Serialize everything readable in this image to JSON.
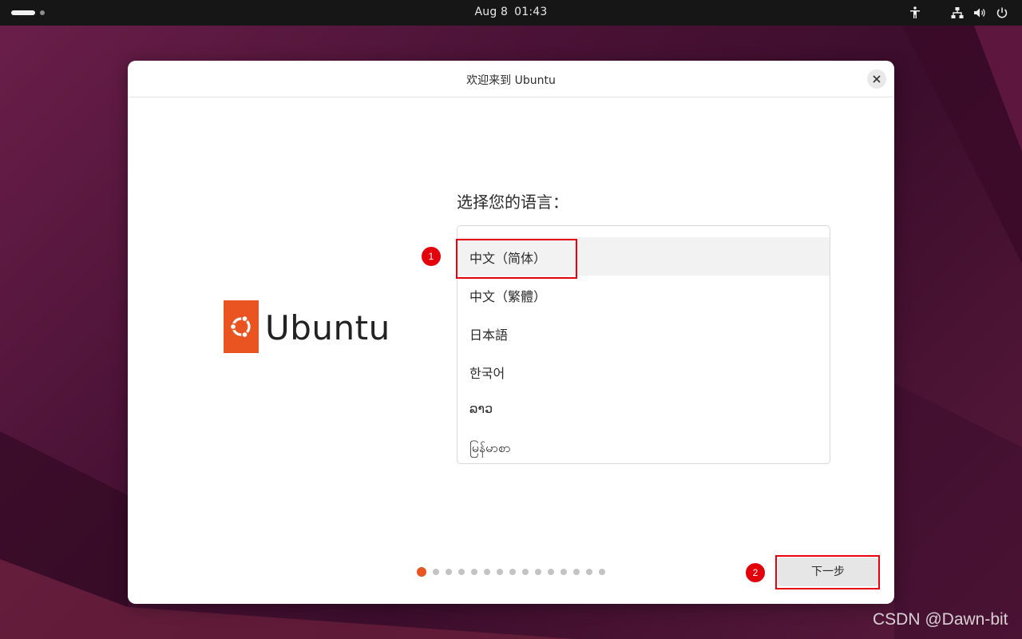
{
  "topbar": {
    "date": "Aug 8",
    "time": "01:43",
    "icons": [
      "accessibility-icon",
      "network-icon",
      "volume-icon",
      "power-icon"
    ]
  },
  "dialog": {
    "title": "欢迎来到 Ubuntu",
    "close_icon": "close-icon"
  },
  "logo": {
    "text": "Ubuntu",
    "color": "#e95420"
  },
  "prompt": "选择您的语言：",
  "languages": [
    {
      "label": "中文（简体）",
      "selected": true
    },
    {
      "label": "中文（繁體）",
      "selected": false
    },
    {
      "label": "日本語",
      "selected": false
    },
    {
      "label": "한국어",
      "selected": false
    },
    {
      "label": "ລາວ",
      "selected": false
    },
    {
      "label": "မြန်မာစာ",
      "selected": false
    }
  ],
  "pagination": {
    "total": 15,
    "current": 1
  },
  "next_button": "下一步",
  "annotations": {
    "marker_1": "1",
    "marker_2": "2",
    "color": "#e3000b"
  },
  "watermark": "CSDN @Dawn-bit",
  "colors": {
    "accent": "#e95420",
    "topbar": "#161616"
  }
}
